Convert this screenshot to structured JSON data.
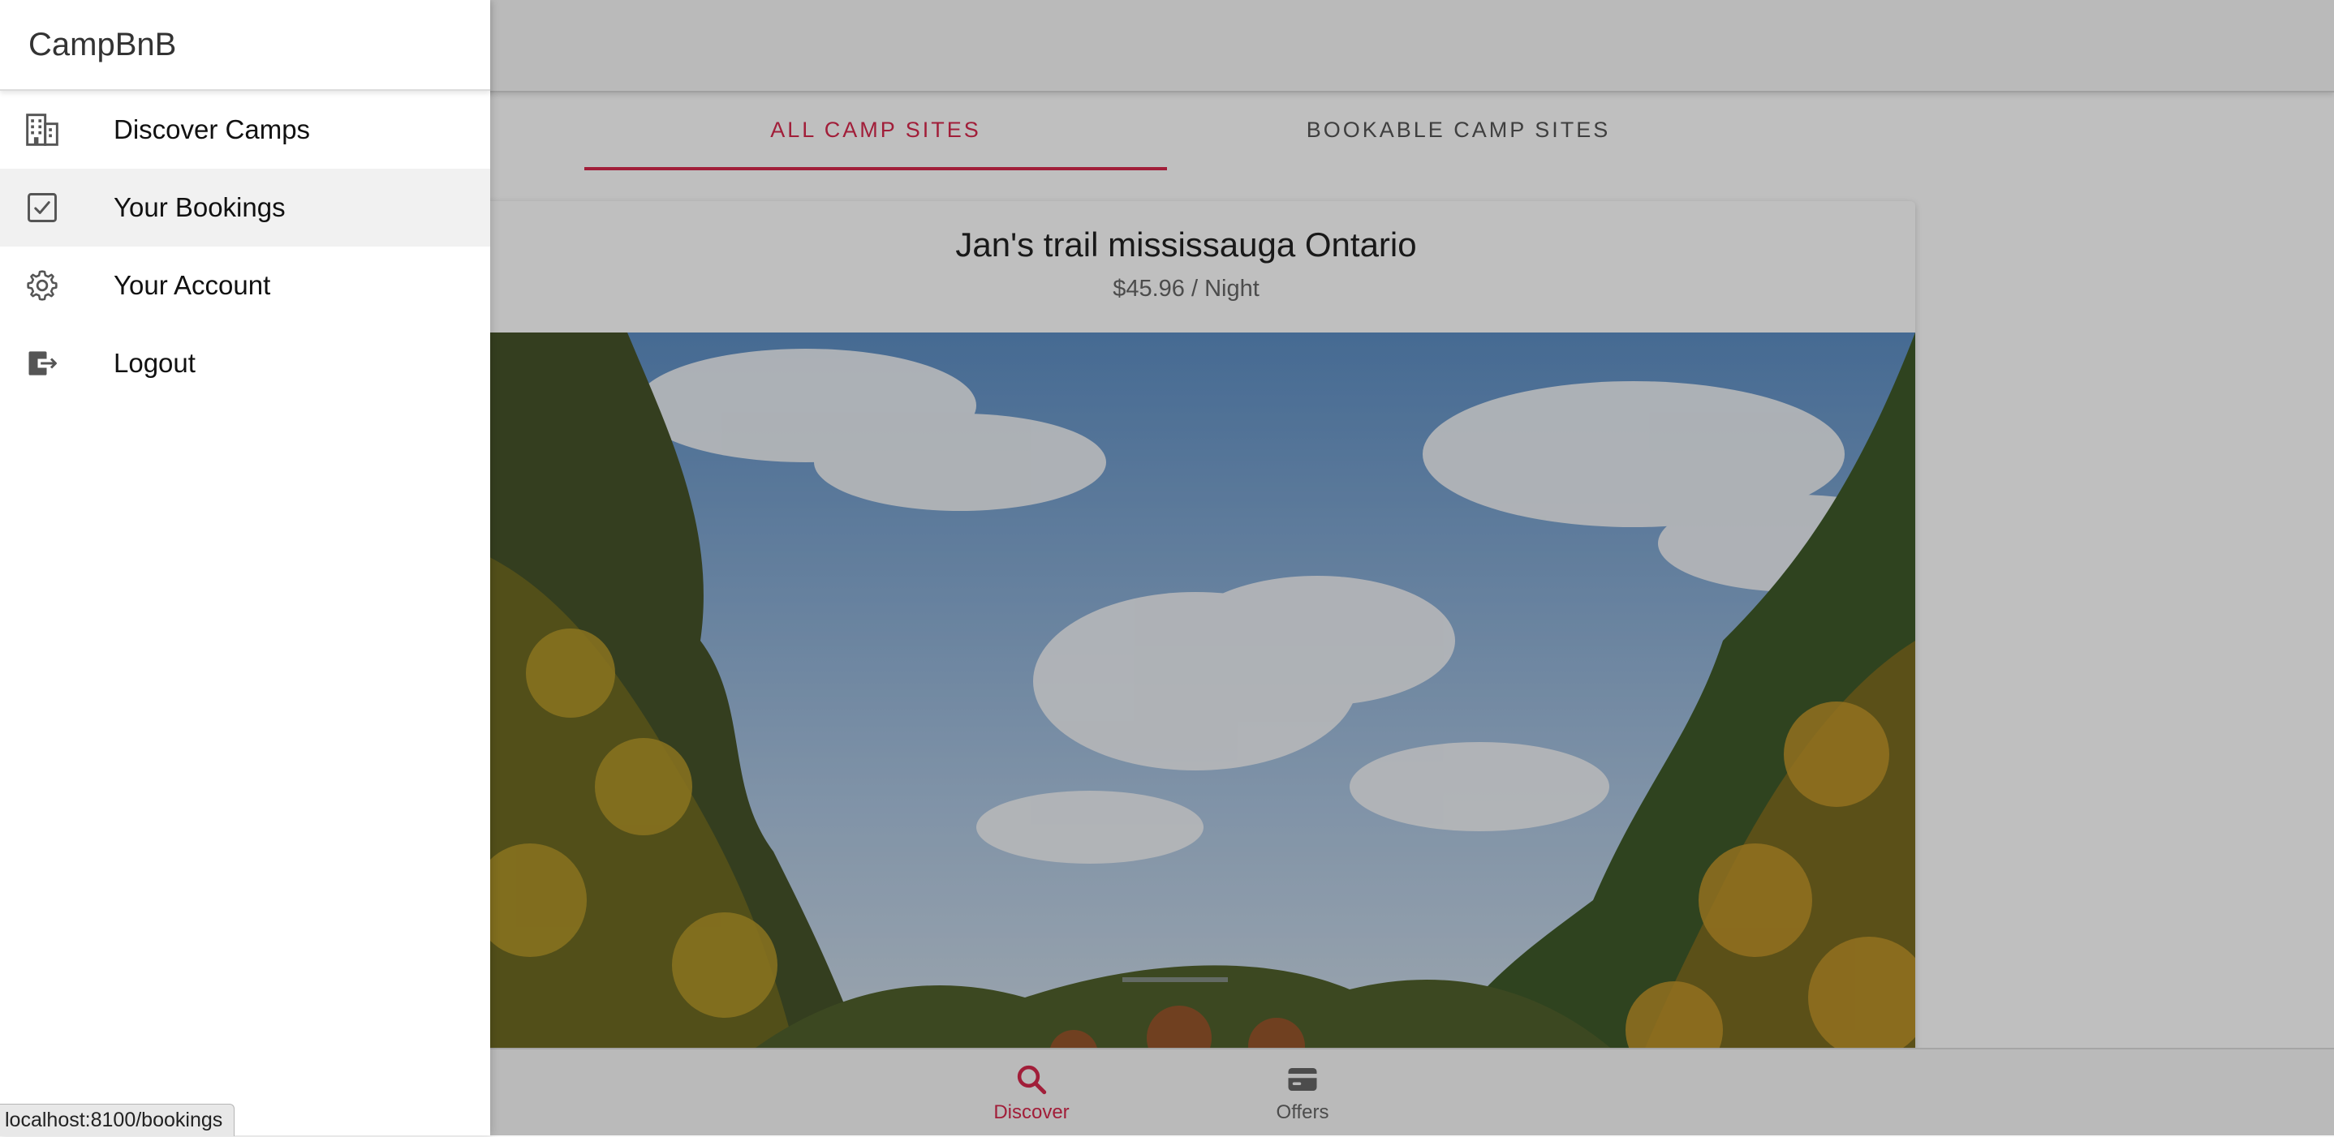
{
  "app": {
    "title": "CampBnB"
  },
  "menu": {
    "items": [
      {
        "label": "Discover Camps",
        "icon": "building-icon"
      },
      {
        "label": "Your Bookings",
        "icon": "checkbox-icon"
      },
      {
        "label": "Your Account",
        "icon": "gear-icon"
      },
      {
        "label": "Logout",
        "icon": "logout-icon"
      }
    ]
  },
  "segments": [
    {
      "label": "ALL CAMP SITES",
      "active": true
    },
    {
      "label": "BOOKABLE CAMP SITES",
      "active": false
    }
  ],
  "card": {
    "title": "Jan's trail mississauga Ontario",
    "price": "$45.96 / Night",
    "image": "landscape-photo"
  },
  "tabs": [
    {
      "label": "Discover",
      "icon": "search-icon",
      "active": true
    },
    {
      "label": "Offers",
      "icon": "card-icon",
      "active": false
    }
  ],
  "status": {
    "url": "localhost:8100/bookings"
  },
  "colors": {
    "accent": "#d7284d",
    "menu_bg": "#ffffff",
    "backdrop": "rgba(0,0,0,0.25)"
  }
}
